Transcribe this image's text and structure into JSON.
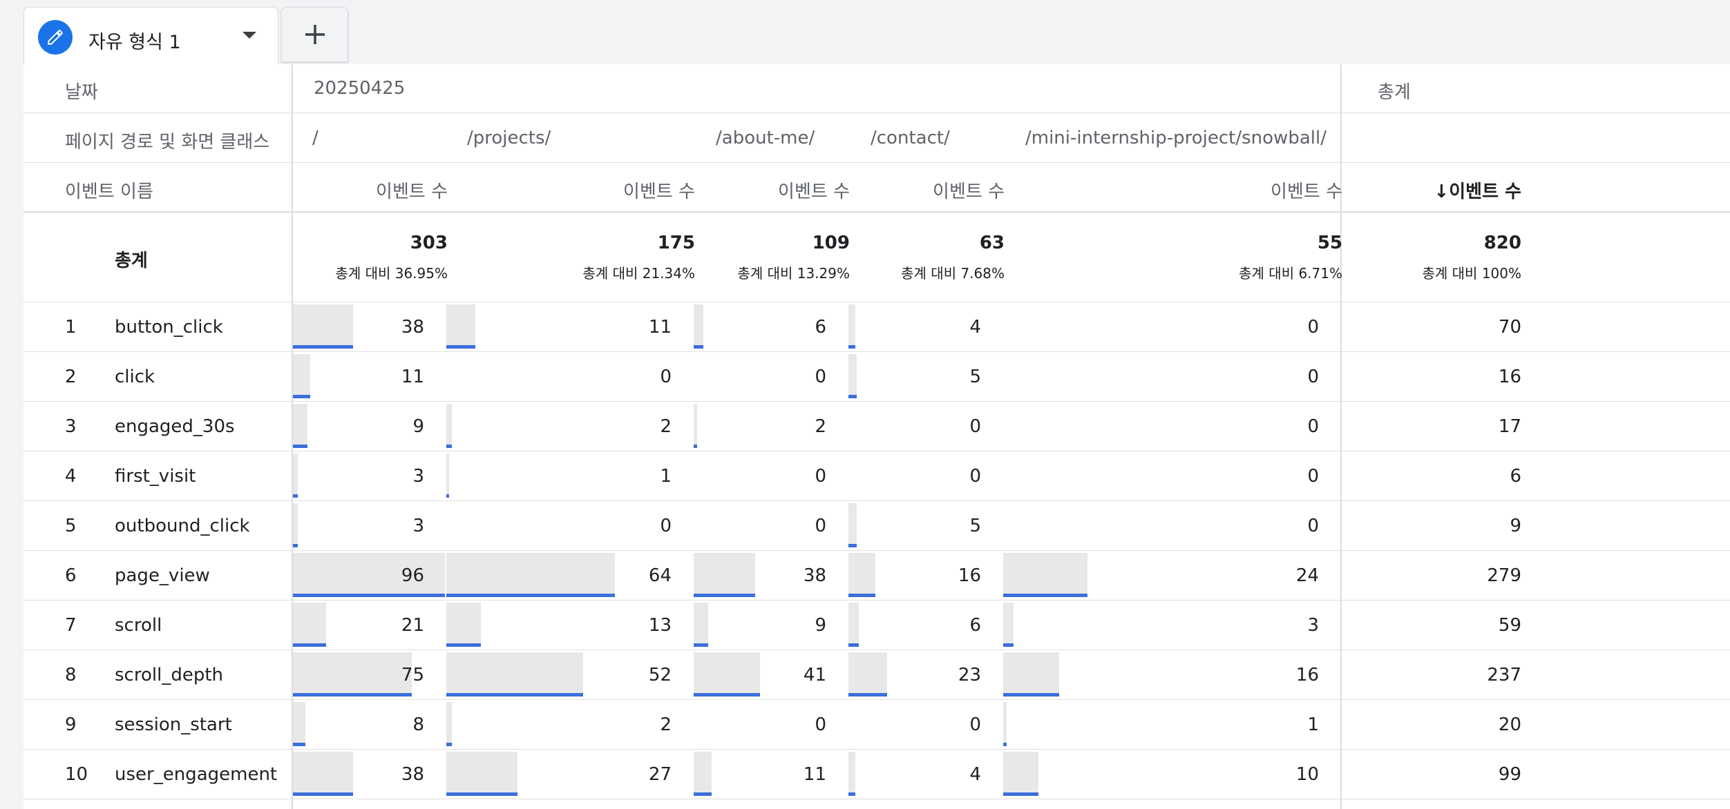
{
  "tab": {
    "label": "자유 형식 1",
    "icon": "pencil-icon",
    "accent": "#1a73e8"
  },
  "add_tab": {
    "icon": "plus-icon"
  },
  "header": {
    "dimension_label": "날짜",
    "date_value": "20250425",
    "total_label": "총계",
    "path_label": "페이지 경로 및 화면 클래스",
    "paths": [
      "/",
      "/projects/",
      "/about-me/",
      "/contact/",
      "/mini-internship-project/snowball/"
    ],
    "event_name_label": "이벤트 이름",
    "metric_labels": [
      "이벤트 수",
      "이벤트 수",
      "이벤트 수",
      "이벤트 수",
      "이벤트 수"
    ],
    "sorted_metric_label": "↓이벤트 수"
  },
  "totals": {
    "label": "총계",
    "values": [
      "303",
      "175",
      "109",
      "63",
      "55"
    ],
    "pcts": [
      "총계 대비 36.95%",
      "총계 대비 21.34%",
      "총계 대비 13.29%",
      "총계 대비 7.68%",
      "총계 대비 6.71%"
    ],
    "grand_value": "820",
    "grand_pct": "총계 대비 100%"
  },
  "rows": [
    {
      "index": "1",
      "name": "button_click",
      "values": [
        "38",
        "11",
        "6",
        "4",
        "0"
      ],
      "total": "70"
    },
    {
      "index": "2",
      "name": "click",
      "values": [
        "11",
        "0",
        "0",
        "5",
        "0"
      ],
      "total": "16"
    },
    {
      "index": "3",
      "name": "engaged_30s",
      "values": [
        "9",
        "2",
        "2",
        "0",
        "0"
      ],
      "total": "17"
    },
    {
      "index": "4",
      "name": "first_visit",
      "values": [
        "3",
        "1",
        "0",
        "0",
        "0"
      ],
      "total": "6"
    },
    {
      "index": "5",
      "name": "outbound_click",
      "values": [
        "3",
        "0",
        "0",
        "5",
        "0"
      ],
      "total": "9"
    },
    {
      "index": "6",
      "name": "page_view",
      "values": [
        "96",
        "64",
        "38",
        "16",
        "24"
      ],
      "total": "279"
    },
    {
      "index": "7",
      "name": "scroll",
      "values": [
        "21",
        "13",
        "9",
        "6",
        "3"
      ],
      "total": "59"
    },
    {
      "index": "8",
      "name": "scroll_depth",
      "values": [
        "75",
        "52",
        "41",
        "23",
        "16"
      ],
      "total": "237"
    },
    {
      "index": "9",
      "name": "session_start",
      "values": [
        "8",
        "2",
        "0",
        "0",
        "1"
      ],
      "total": "20"
    },
    {
      "index": "10",
      "name": "user_engagement",
      "values": [
        "38",
        "27",
        "11",
        "4",
        "10"
      ],
      "total": "99"
    }
  ],
  "colors": {
    "bar_fill": "#e8e8e8",
    "bar_accent": "#3b6fd9"
  }
}
